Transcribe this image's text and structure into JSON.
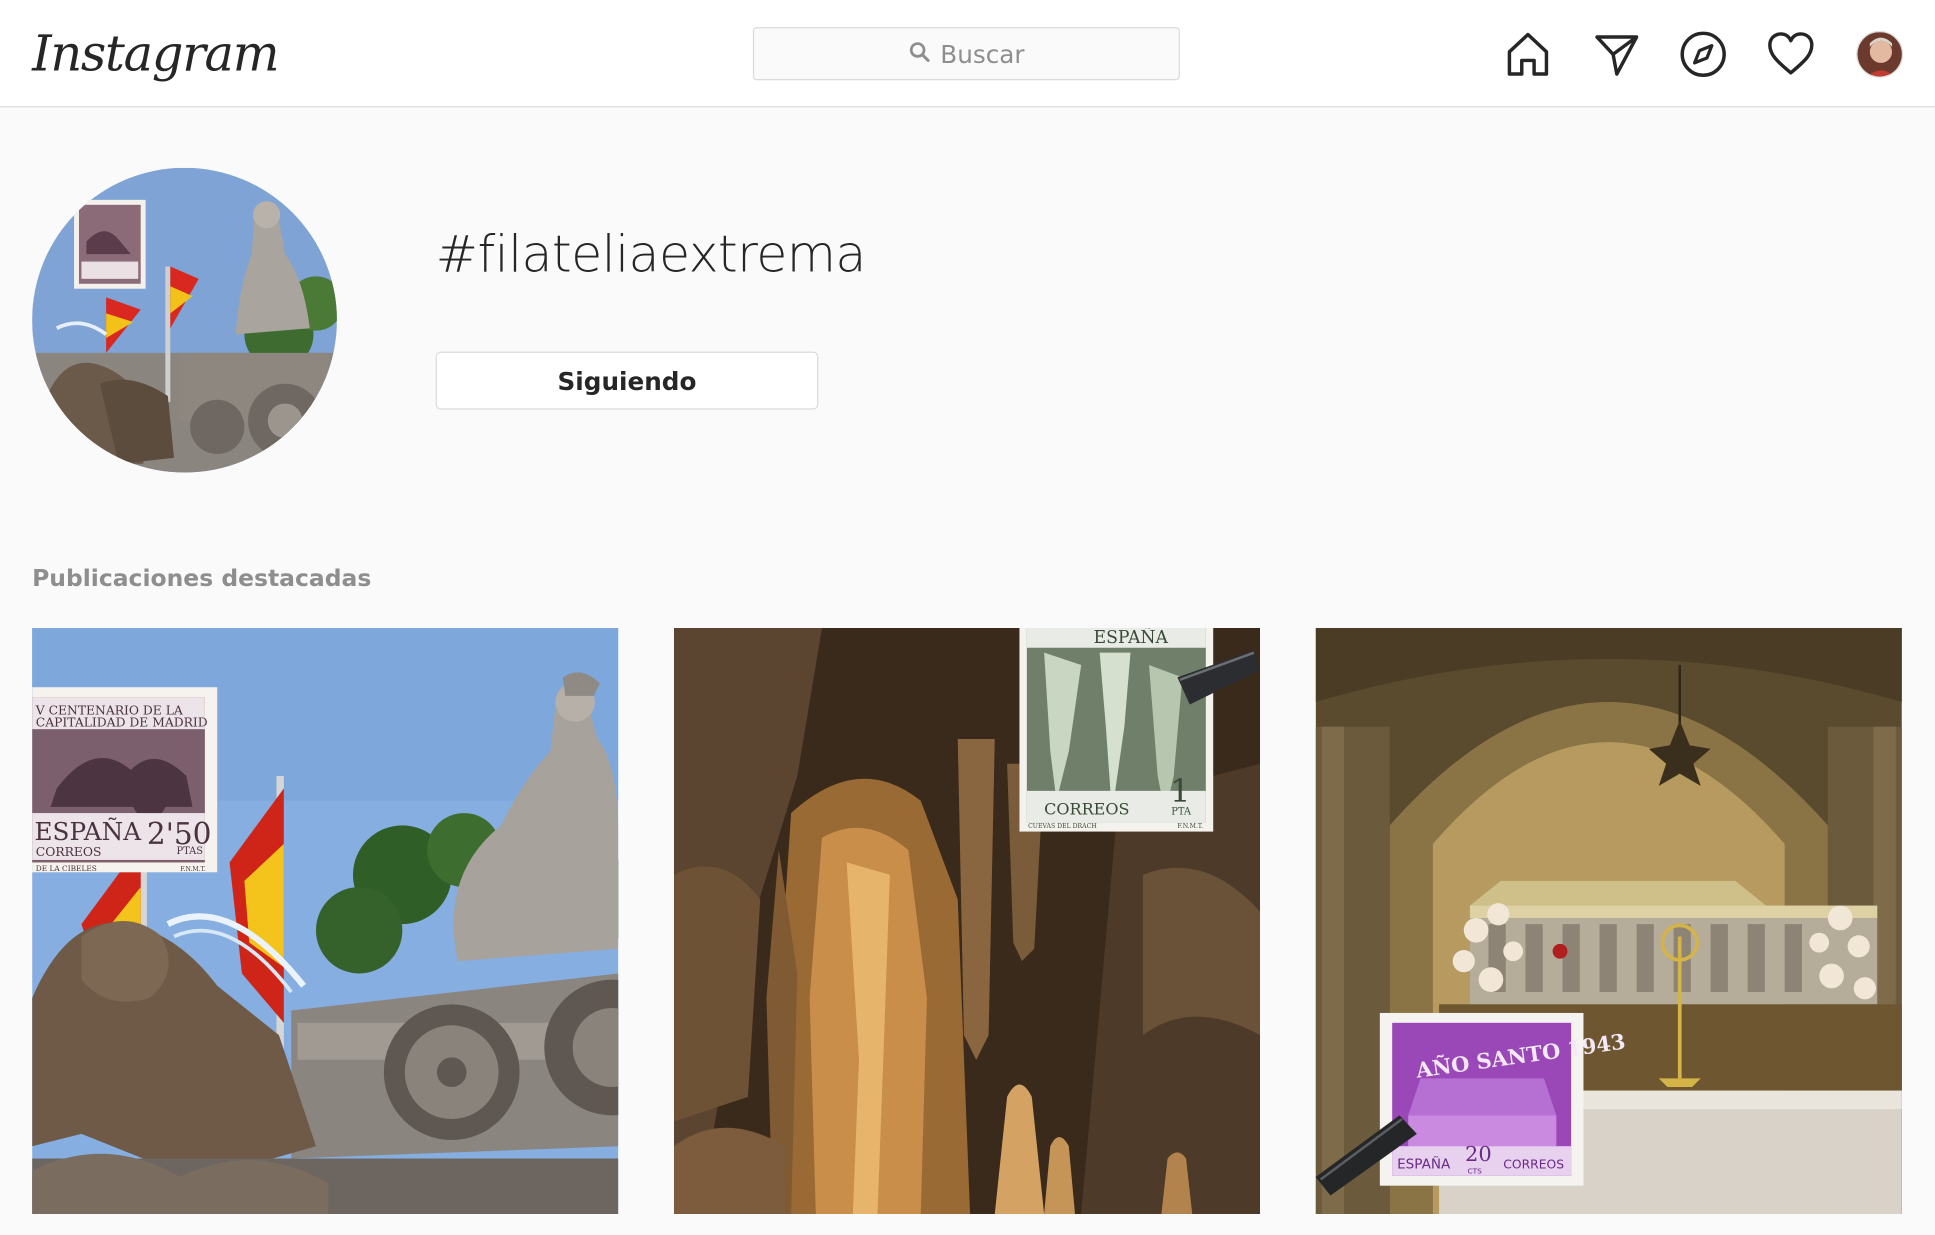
{
  "header": {
    "logo": "Instagram",
    "search_placeholder": "Buscar",
    "icons": [
      "home-icon",
      "direct-icon",
      "explore-icon",
      "activity-icon",
      "profile-avatar"
    ]
  },
  "profile": {
    "hashtag": "#filateliaextrema",
    "follow_label": "Siguiendo"
  },
  "section": {
    "title": "Publicaciones destacadas"
  },
  "posts": [
    {
      "subject": "Cibeles fountain with stamp",
      "stamp_text": {
        "line1": "V CENTENARIO DE LA",
        "line2": "CAPITALIDAD DE MADRID",
        "country": "ESPAÑA",
        "value": "2'50",
        "unit": "PTAS",
        "service": "CORREOS",
        "footer": "DE LA CIBELES",
        "mark": "F.N.M.T."
      }
    },
    {
      "subject": "Cuevas del Drach with stamp",
      "stamp_text": {
        "country": "ESPAÑA",
        "service": "CORREOS",
        "value": "1",
        "unit": "PTA",
        "footer": "CUEVAS DEL DRACH",
        "mark": "F.N.M.T."
      }
    },
    {
      "subject": "Tomb of the Apostle with stamp",
      "stamp_text": {
        "title": "AÑO SANTO 1943",
        "country": "ESPAÑA",
        "value": "20",
        "unit": "CTS",
        "service": "CORREOS"
      }
    }
  ],
  "colors": {
    "background": "#fafafa",
    "header_bg": "#ffffff",
    "border": "#dbdbdb",
    "text_primary": "#262626",
    "text_secondary": "#8e8e8e"
  }
}
